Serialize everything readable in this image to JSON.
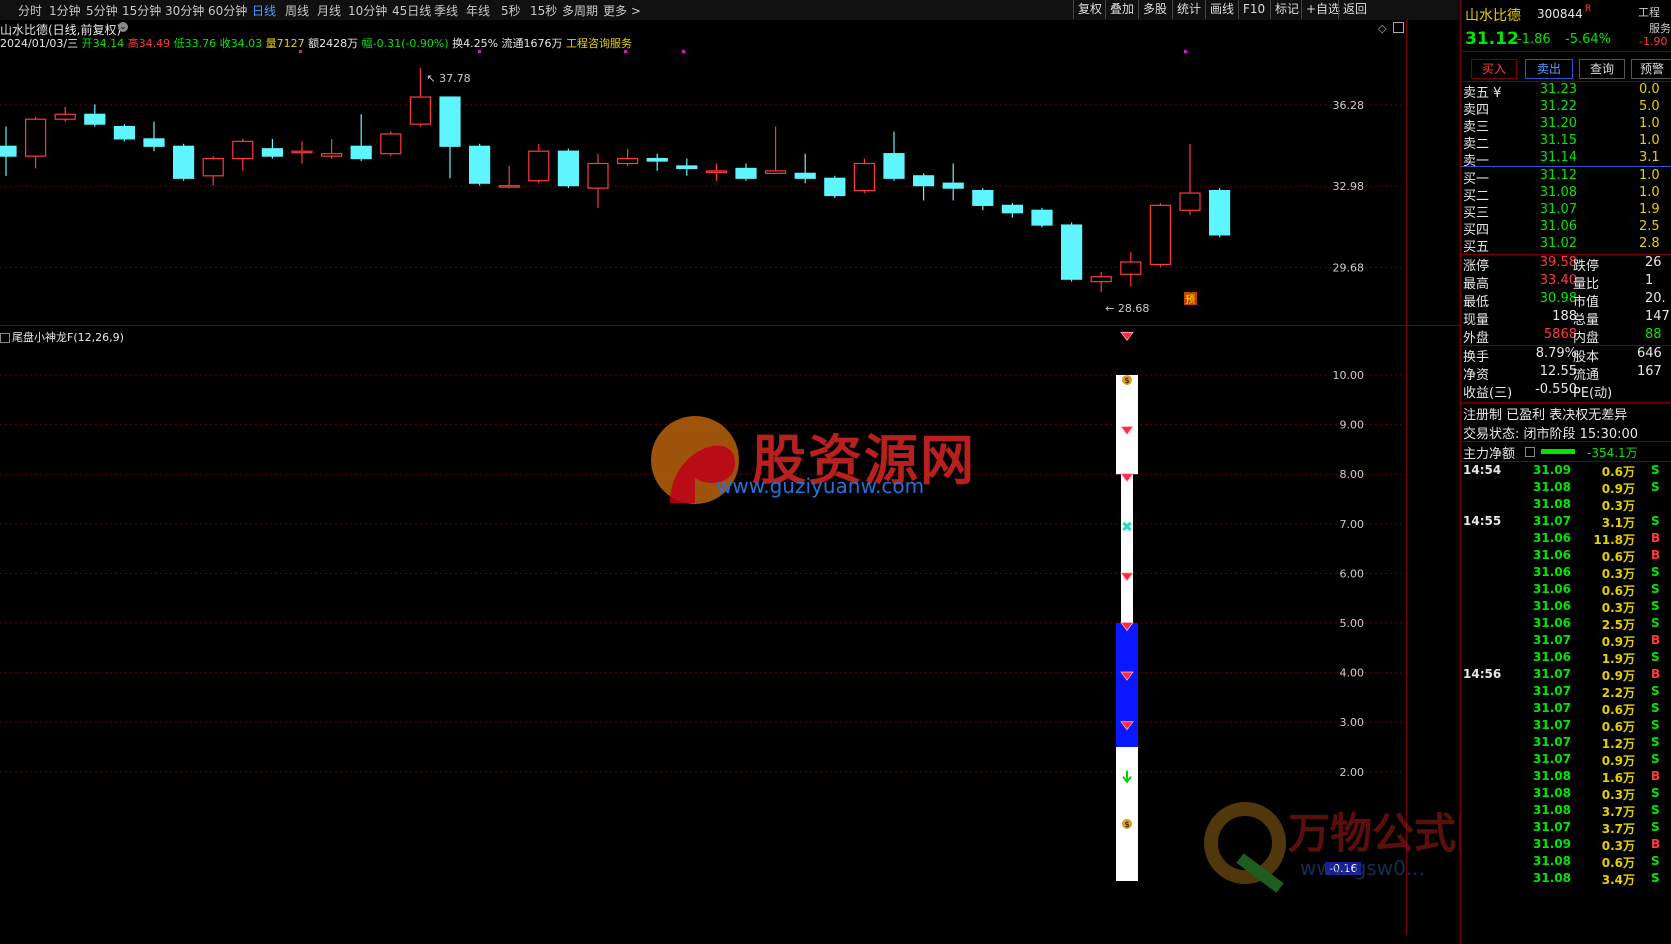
{
  "toolbar": {
    "periods": [
      "分时",
      "1分钟",
      "5分钟",
      "15分钟",
      "30分钟",
      "60分钟",
      "日线",
      "周线",
      "月线",
      "10分钟",
      "45日线",
      "季线",
      "年线",
      "5秒",
      "15秒",
      "多周期",
      "更多 >"
    ],
    "active_index": 6,
    "right_items": [
      "复权",
      "叠加",
      "多股",
      "统计",
      "画线",
      "F10",
      "标记",
      "+自选",
      "返回"
    ]
  },
  "chart": {
    "title": "山水比德(日线,前复权)",
    "info": {
      "date": "2024/01/03/三",
      "open": "开34.14",
      "high": "高34.49",
      "low": "低33.76",
      "close": "收34.03",
      "volume": "量7127",
      "amount": "额2428万",
      "change": "幅-0.31(-0.90%)",
      "turnover": "换4.25%",
      "float": "流通1676万",
      "service": "工程咨询服务"
    },
    "high_marker": "37.78",
    "low_marker": "28.68",
    "pre_badge": "预",
    "price_axis": [
      "36.28",
      "32.98",
      "29.68"
    ],
    "candles": [
      {
        "o": 34.6,
        "c": 34.2,
        "h": 35.4,
        "l": 33.4
      },
      {
        "o": 34.2,
        "c": 35.7,
        "h": 35.8,
        "l": 33.7
      },
      {
        "o": 35.7,
        "c": 35.9,
        "h": 36.2,
        "l": 35.6
      },
      {
        "o": 35.9,
        "c": 35.5,
        "h": 36.3,
        "l": 35.4
      },
      {
        "o": 35.4,
        "c": 34.9,
        "h": 35.5,
        "l": 34.8
      },
      {
        "o": 34.9,
        "c": 34.6,
        "h": 35.6,
        "l": 34.4
      },
      {
        "o": 34.6,
        "c": 33.3,
        "h": 34.7,
        "l": 33.2
      },
      {
        "o": 33.4,
        "c": 34.1,
        "h": 34.2,
        "l": 33.0
      },
      {
        "o": 34.1,
        "c": 34.8,
        "h": 34.9,
        "l": 33.6
      },
      {
        "o": 34.5,
        "c": 34.2,
        "h": 34.9,
        "l": 34.1
      },
      {
        "o": 34.4,
        "c": 34.4,
        "h": 34.8,
        "l": 33.9
      },
      {
        "o": 34.2,
        "c": 34.3,
        "h": 34.9,
        "l": 34.1
      },
      {
        "o": 34.6,
        "c": 34.1,
        "h": 35.9,
        "l": 34.0
      },
      {
        "o": 34.3,
        "c": 35.1,
        "h": 35.2,
        "l": 34.2
      },
      {
        "o": 35.5,
        "c": 36.6,
        "h": 37.78,
        "l": 35.4
      },
      {
        "o": 36.6,
        "c": 34.6,
        "h": 36.6,
        "l": 33.3
      },
      {
        "o": 34.6,
        "c": 33.1,
        "h": 34.7,
        "l": 33.0
      },
      {
        "o": 33.0,
        "c": 33.0,
        "h": 33.8,
        "l": 32.9
      },
      {
        "o": 33.2,
        "c": 34.4,
        "h": 34.7,
        "l": 33.1
      },
      {
        "o": 34.4,
        "c": 33.0,
        "h": 34.5,
        "l": 32.9
      },
      {
        "o": 32.9,
        "c": 33.9,
        "h": 34.3,
        "l": 32.1
      },
      {
        "o": 33.9,
        "c": 34.1,
        "h": 34.5,
        "l": 33.8
      },
      {
        "o": 34.1,
        "c": 34.0,
        "h": 34.3,
        "l": 33.6
      },
      {
        "o": 33.8,
        "c": 33.7,
        "h": 34.1,
        "l": 33.4
      },
      {
        "o": 33.6,
        "c": 33.6,
        "h": 33.9,
        "l": 33.2
      },
      {
        "o": 33.7,
        "c": 33.3,
        "h": 33.9,
        "l": 33.2
      },
      {
        "o": 33.5,
        "c": 33.6,
        "h": 35.4,
        "l": 33.5
      },
      {
        "o": 33.5,
        "c": 33.3,
        "h": 34.3,
        "l": 33.1
      },
      {
        "o": 33.3,
        "c": 32.6,
        "h": 33.4,
        "l": 32.5
      },
      {
        "o": 32.8,
        "c": 33.9,
        "h": 34.1,
        "l": 32.7
      },
      {
        "o": 34.3,
        "c": 33.3,
        "h": 35.2,
        "l": 33.2
      },
      {
        "o": 33.4,
        "c": 33.0,
        "h": 33.5,
        "l": 32.4
      },
      {
        "o": 33.1,
        "c": 32.9,
        "h": 33.9,
        "l": 32.4
      },
      {
        "o": 32.8,
        "c": 32.2,
        "h": 32.9,
        "l": 32.0
      },
      {
        "o": 32.2,
        "c": 31.9,
        "h": 32.3,
        "l": 31.7
      },
      {
        "o": 32.0,
        "c": 31.4,
        "h": 32.1,
        "l": 31.3
      },
      {
        "o": 31.4,
        "c": 29.2,
        "h": 31.5,
        "l": 29.1
      },
      {
        "o": 29.1,
        "c": 29.3,
        "h": 29.5,
        "l": 28.68
      },
      {
        "o": 29.4,
        "c": 29.9,
        "h": 30.3,
        "l": 28.9
      },
      {
        "o": 29.8,
        "c": 32.2,
        "h": 32.3,
        "l": 29.7
      },
      {
        "o": 32.0,
        "c": 32.7,
        "h": 34.7,
        "l": 31.8
      },
      {
        "o": 32.8,
        "c": 31.0,
        "h": 32.9,
        "l": 30.9
      }
    ],
    "indicator": {
      "title": "尾盘小神龙F(12,26,9)",
      "axis": [
        "10.00",
        "9.00",
        "8.00",
        "7.00",
        "6.00",
        "5.00",
        "4.00",
        "3.00",
        "2.00"
      ],
      "bottom_value": "-0.16"
    }
  },
  "panel": {
    "name": "山水比德",
    "code": "300844",
    "code_mark": "R",
    "tag": "工程",
    "tag2": "服务",
    "price": "31.12",
    "change": "-1.86",
    "change_pct": "-5.64%",
    "side_value": "-1.90",
    "buttons": [
      "买入",
      "卖出",
      "查询",
      "预警"
    ],
    "asks": [
      {
        "label": "卖五 ¥",
        "price": "31.23",
        "vol": "0.0"
      },
      {
        "label": "卖四",
        "price": "31.22",
        "vol": "5.0"
      },
      {
        "label": "卖三",
        "price": "31.20",
        "vol": "1.0"
      },
      {
        "label": "卖二",
        "price": "31.15",
        "vol": "1.0"
      },
      {
        "label": "卖一",
        "price": "31.14",
        "vol": "3.1"
      }
    ],
    "bids": [
      {
        "label": "买一",
        "price": "31.12",
        "vol": "1.0"
      },
      {
        "label": "买二",
        "price": "31.08",
        "vol": "1.0"
      },
      {
        "label": "买三",
        "price": "31.07",
        "vol": "1.9"
      },
      {
        "label": "买四",
        "price": "31.06",
        "vol": "2.5"
      },
      {
        "label": "买五",
        "price": "31.02",
        "vol": "2.8"
      }
    ],
    "stats": [
      {
        "l1": "涨停",
        "v1": "39.58",
        "l2": "跌停",
        "v2": "26",
        "c": "red"
      },
      {
        "l1": "最高",
        "v1": "33.40",
        "l2": "量比",
        "v2": "1",
        "c": "red"
      },
      {
        "l1": "最低",
        "v1": "30.98",
        "l2": "市值",
        "v2": "20.",
        "c": "green"
      },
      {
        "l1": "现量",
        "v1": "188",
        "l2": "总量",
        "v2": "147",
        "c": "white"
      },
      {
        "l1": "外盘",
        "v1": "5868",
        "l2": "内盘",
        "v2": "88",
        "c": "red"
      }
    ],
    "stats2": [
      {
        "l1": "换手",
        "v1": "8.79%",
        "l2": "股本",
        "v2": "646"
      },
      {
        "l1": "净资",
        "v1": "12.55",
        "l2": "流通",
        "v2": "167"
      },
      {
        "l1": "收益(三)",
        "v1": "-0.550",
        "l2": "PE(动)",
        "v2": ""
      }
    ],
    "flags": "注册制 已盈利 表决权无差异",
    "status": "交易状态: 闭市阶段 15:30:00",
    "main_net_label": "主力净额",
    "main_net_value": "-354.1万",
    "ticks": [
      {
        "t": "14:54",
        "p": "31.09",
        "v": "0.6万",
        "s": "S"
      },
      {
        "t": "",
        "p": "31.08",
        "v": "0.9万",
        "s": "S"
      },
      {
        "t": "",
        "p": "31.08",
        "v": "0.3万",
        "s": ""
      },
      {
        "t": "14:55",
        "p": "31.07",
        "v": "3.1万",
        "s": "S"
      },
      {
        "t": "",
        "p": "31.06",
        "v": "11.8万",
        "s": "B"
      },
      {
        "t": "",
        "p": "31.06",
        "v": "0.6万",
        "s": "B"
      },
      {
        "t": "",
        "p": "31.06",
        "v": "0.3万",
        "s": "S"
      },
      {
        "t": "",
        "p": "31.06",
        "v": "0.6万",
        "s": "S"
      },
      {
        "t": "",
        "p": "31.06",
        "v": "0.3万",
        "s": "S"
      },
      {
        "t": "",
        "p": "31.06",
        "v": "2.5万",
        "s": "S"
      },
      {
        "t": "",
        "p": "31.07",
        "v": "0.9万",
        "s": "B"
      },
      {
        "t": "",
        "p": "31.06",
        "v": "1.9万",
        "s": "S"
      },
      {
        "t": "14:56",
        "p": "31.07",
        "v": "0.9万",
        "s": "B"
      },
      {
        "t": "",
        "p": "31.07",
        "v": "2.2万",
        "s": "S"
      },
      {
        "t": "",
        "p": "31.07",
        "v": "0.6万",
        "s": "S"
      },
      {
        "t": "",
        "p": "31.07",
        "v": "0.6万",
        "s": "S"
      },
      {
        "t": "",
        "p": "31.07",
        "v": "1.2万",
        "s": "S"
      },
      {
        "t": "",
        "p": "31.07",
        "v": "0.9万",
        "s": "S"
      },
      {
        "t": "",
        "p": "31.08",
        "v": "1.6万",
        "s": "B"
      },
      {
        "t": "",
        "p": "31.08",
        "v": "0.3万",
        "s": "S"
      },
      {
        "t": "",
        "p": "31.08",
        "v": "3.7万",
        "s": "S"
      },
      {
        "t": "",
        "p": "31.07",
        "v": "3.7万",
        "s": "S"
      },
      {
        "t": "",
        "p": "31.09",
        "v": "0.3万",
        "s": "B"
      },
      {
        "t": "",
        "p": "31.08",
        "v": "0.6万",
        "s": "S"
      },
      {
        "t": "",
        "p": "31.08",
        "v": "3.4万",
        "s": "S"
      }
    ]
  },
  "watermarks": {
    "wm1_text": "股资源网",
    "wm1_url": "www.guziyuanw.com",
    "wm2_text": "万物公式网",
    "wm2_url": "www.gsw0..."
  },
  "colors": {
    "up": "#ff3a3a",
    "down": "#5ff5ff",
    "grid": "#6a0000",
    "bg": "#000000",
    "accent": "#4f9dff"
  }
}
